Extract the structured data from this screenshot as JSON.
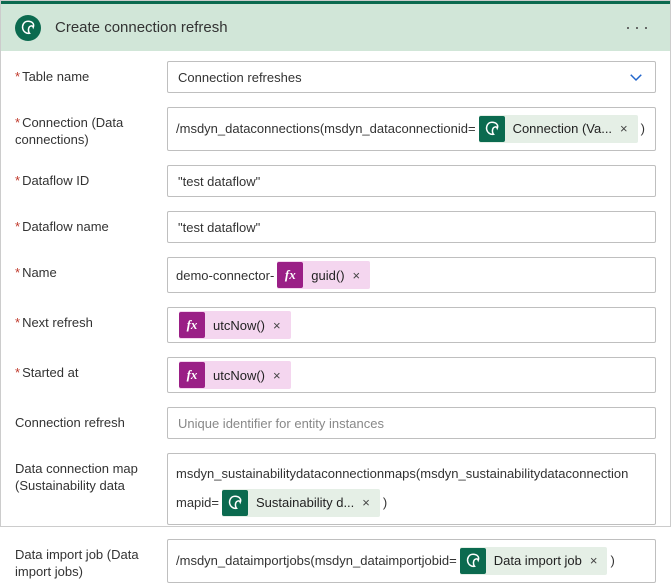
{
  "header": {
    "title": "Create connection refresh",
    "more_label": "···"
  },
  "tableName": {
    "label": "Table name",
    "value": "Connection refreshes"
  },
  "connection": {
    "label": "Connection (Data connections)",
    "prefix": "/msdyn_dataconnections(msdyn_dataconnectionid=",
    "chip": "Connection (Va...",
    "suffix": ")"
  },
  "dataflowId": {
    "label": "Dataflow ID",
    "value": "\"test dataflow\""
  },
  "dataflowName": {
    "label": "Dataflow name",
    "value": "\"test dataflow\""
  },
  "name": {
    "label": "Name",
    "prefix": "demo-connector-",
    "chip": "guid()"
  },
  "nextRefresh": {
    "label": "Next refresh",
    "chip": "utcNow()"
  },
  "startedAt": {
    "label": "Started at",
    "chip": "utcNow()"
  },
  "connectionRefresh": {
    "label": "Connection refresh",
    "placeholder": "Unique identifier for entity instances"
  },
  "dataConnectionMap": {
    "label": "Data connection map (Sustainability data",
    "prefix": "msdyn_sustainabilitydataconnectionmaps(msdyn_sustainabilitydataconnection",
    "prefix2": "mapid=",
    "chip": "Sustainability d...",
    "suffix": ")"
  },
  "dataImportJob": {
    "label": "Data import job (Data import jobs)",
    "prefix": "/msdyn_dataimportjobs(msdyn_dataimportjobid=",
    "chip": "Data import job",
    "suffix": ")"
  },
  "icons": {
    "fx": "fx",
    "x": "×"
  }
}
